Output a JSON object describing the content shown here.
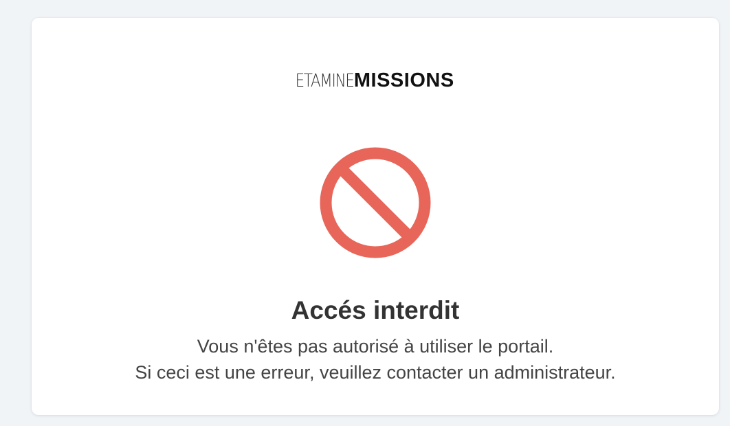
{
  "logo": {
    "light": "ETAMINE",
    "bold": "MISSIONS"
  },
  "error": {
    "icon": "forbidden-icon",
    "icon_color": "#e8655a",
    "title": "Accés interdit",
    "line1": "Vous n'êtes pas autorisé à utiliser le portail.",
    "line2": "Si ceci est une erreur, veuillez contacter un administrateur."
  }
}
